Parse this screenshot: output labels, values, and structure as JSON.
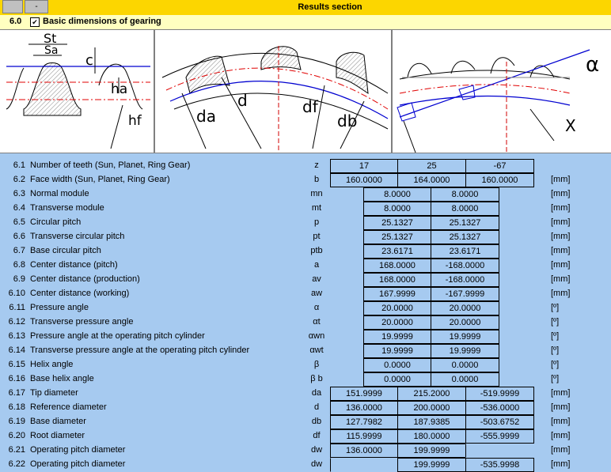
{
  "header": {
    "btn1": "",
    "btn2": "-",
    "title": "Results section"
  },
  "section": {
    "number": "6.0",
    "check": "✔",
    "title": "Basic dimensions of gearing"
  },
  "diagram": {
    "labels": {
      "st": "St",
      "sa": "Sa",
      "c": "c",
      "ha": "ha",
      "hf": "hf",
      "da": "da",
      "d": "d",
      "df": "df",
      "db": "db",
      "alpha": "α",
      "x": "X"
    }
  },
  "units": {
    "mm": "[mm]",
    "deg": "[º]"
  },
  "rows": [
    {
      "num": "6.1",
      "label": "Number of teeth (Sun, Planet, Ring Gear)",
      "sym": "z",
      "vals": [
        "17",
        "25",
        "-67"
      ],
      "unit": ""
    },
    {
      "num": "6.2",
      "label": "Face width (Sun, Planet, Ring Gear)",
      "sym": "b",
      "vals": [
        "160.0000",
        "164.0000",
        "160.0000"
      ],
      "unit": "[mm]"
    },
    {
      "num": "6.3",
      "label": "Normal module",
      "sym": "mn",
      "vals": [
        "8.0000",
        "8.0000"
      ],
      "unit": "[mm]"
    },
    {
      "num": "6.4",
      "label": "Transverse module",
      "sym": "mt",
      "vals": [
        "8.0000",
        "8.0000"
      ],
      "unit": "[mm]"
    },
    {
      "num": "6.5",
      "label": "Circular pitch",
      "sym": "p",
      "vals": [
        "25.1327",
        "25.1327"
      ],
      "unit": "[mm]"
    },
    {
      "num": "6.6",
      "label": "Transverse circular pitch",
      "sym": "pt",
      "vals": [
        "25.1327",
        "25.1327"
      ],
      "unit": "[mm]"
    },
    {
      "num": "6.7",
      "label": "Base circular pitch",
      "sym": "ptb",
      "vals": [
        "23.6171",
        "23.6171"
      ],
      "unit": "[mm]"
    },
    {
      "num": "6.8",
      "label": "Center distance (pitch)",
      "sym": "a",
      "vals": [
        "168.0000",
        "-168.0000"
      ],
      "unit": "[mm]"
    },
    {
      "num": "6.9",
      "label": "Center distance (production)",
      "sym": "av",
      "vals": [
        "168.0000",
        "-168.0000"
      ],
      "unit": "[mm]"
    },
    {
      "num": "6.10",
      "label": "Center distance (working)",
      "sym": "aw",
      "vals": [
        "167.9999",
        "-167.9999"
      ],
      "unit": "[mm]"
    },
    {
      "num": "6.11",
      "label": "Pressure angle",
      "sym": "α",
      "vals": [
        "20.0000",
        "20.0000"
      ],
      "unit": "[º]"
    },
    {
      "num": "6.12",
      "label": "Transverse pressure angle",
      "sym": "αt",
      "vals": [
        "20.0000",
        "20.0000"
      ],
      "unit": "[º]"
    },
    {
      "num": "6.13",
      "label": "Pressure angle at the operating pitch cylinder",
      "sym": "αwn",
      "vals": [
        "19.9999",
        "19.9999"
      ],
      "unit": "[º]"
    },
    {
      "num": "6.14",
      "label": "Transverse pressure angle at the operating pitch cylinder",
      "sym": "αwt",
      "vals": [
        "19.9999",
        "19.9999"
      ],
      "unit": "[º]"
    },
    {
      "num": "6.15",
      "label": "Helix angle",
      "sym": "β",
      "vals": [
        "0.0000",
        "0.0000"
      ],
      "unit": "[º]"
    },
    {
      "num": "6.16",
      "label": "Base helix angle",
      "sym": "β b",
      "vals": [
        "0.0000",
        "0.0000"
      ],
      "unit": "[º]"
    },
    {
      "num": "6.17",
      "label": "Tip diameter",
      "sym": "da",
      "vals": [
        "151.9999",
        "215.2000",
        "-519.9999"
      ],
      "unit": "[mm]"
    },
    {
      "num": "6.18",
      "label": "Reference diameter",
      "sym": "d",
      "vals": [
        "136.0000",
        "200.0000",
        "-536.0000"
      ],
      "unit": "[mm]"
    },
    {
      "num": "6.19",
      "label": "Base diameter",
      "sym": "db",
      "vals": [
        "127.7982",
        "187.9385",
        "-503.6752"
      ],
      "unit": "[mm]"
    },
    {
      "num": "6.20",
      "label": "Root diameter",
      "sym": "df",
      "vals": [
        "115.9999",
        "180.0000",
        "-555.9999"
      ],
      "unit": "[mm]"
    },
    {
      "num": "6.21",
      "label": "Operating pitch diameter",
      "sym": "dw",
      "vals": [
        "136.0000",
        "199.9999",
        ""
      ],
      "unit": "[mm]"
    },
    {
      "num": "6.22",
      "label": "Operating pitch diameter",
      "sym": "dw",
      "vals": [
        "",
        "199.9999",
        "-535.9998"
      ],
      "unit": "[mm]"
    }
  ]
}
